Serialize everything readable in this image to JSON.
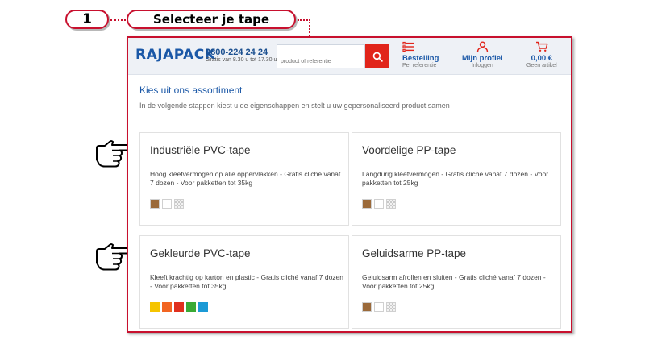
{
  "callout": {
    "step_number": "1",
    "step_title": "Selecteer je tape"
  },
  "header": {
    "logo": "RAJAPACK",
    "phone": "0800-224 24 24",
    "hours": "Gratis van 8.30 u tot 17.30 u",
    "search_placeholder": "product of referentie",
    "order": {
      "label": "Bestelling",
      "sub": "Per referentie"
    },
    "profile": {
      "label": "Mijn profiel",
      "sub": "Inloggen"
    },
    "cart": {
      "label": "0,00 €",
      "sub": "Geen artikel"
    }
  },
  "intro": {
    "title": "Kies uit ons assortiment",
    "text": "In de volgende stappen kiest u de eigenschappen en stelt u uw gepersonaliseerd product samen"
  },
  "cards": [
    {
      "title": "Industriële PVC-tape",
      "description": "Hoog kleefvermogen op alle oppervlakken - Gratis cliché vanaf 7 dozen - Voor pakketten tot 35kg",
      "swatches": [
        "#9b6a3a",
        "#ffffff",
        "clear"
      ]
    },
    {
      "title": "Voordelige PP-tape",
      "description": "Langdurig kleefvermogen - Gratis cliché vanaf 7 dozen - Voor pakketten tot 25kg",
      "swatches": [
        "#9b6a3a",
        "#ffffff",
        "clear"
      ]
    },
    {
      "title": "Gekleurde PVC-tape",
      "description": "Kleeft krachtig op karton en plastic - Gratis cliché vanaf 7 dozen - Voor pakketten tot 35kg",
      "swatches": [
        "#f5c400",
        "#f26522",
        "#e0301e",
        "#3aaa35",
        "#1c9ad6"
      ]
    },
    {
      "title": "Geluidsarme PP-tape",
      "description": "Geluidsarm afrollen en sluiten - Gratis cliché vanaf 7 dozen - Voor pakketten tot 25kg",
      "swatches": [
        "#9b6a3a",
        "#ffffff",
        "clear"
      ]
    }
  ],
  "colors": {
    "accent_red": "#c8102e",
    "brand_blue": "#1b58a7",
    "search_red": "#e1251b"
  },
  "icons": [
    "pointing-hand-icon",
    "search-icon",
    "list-icon",
    "user-icon",
    "cart-icon"
  ]
}
